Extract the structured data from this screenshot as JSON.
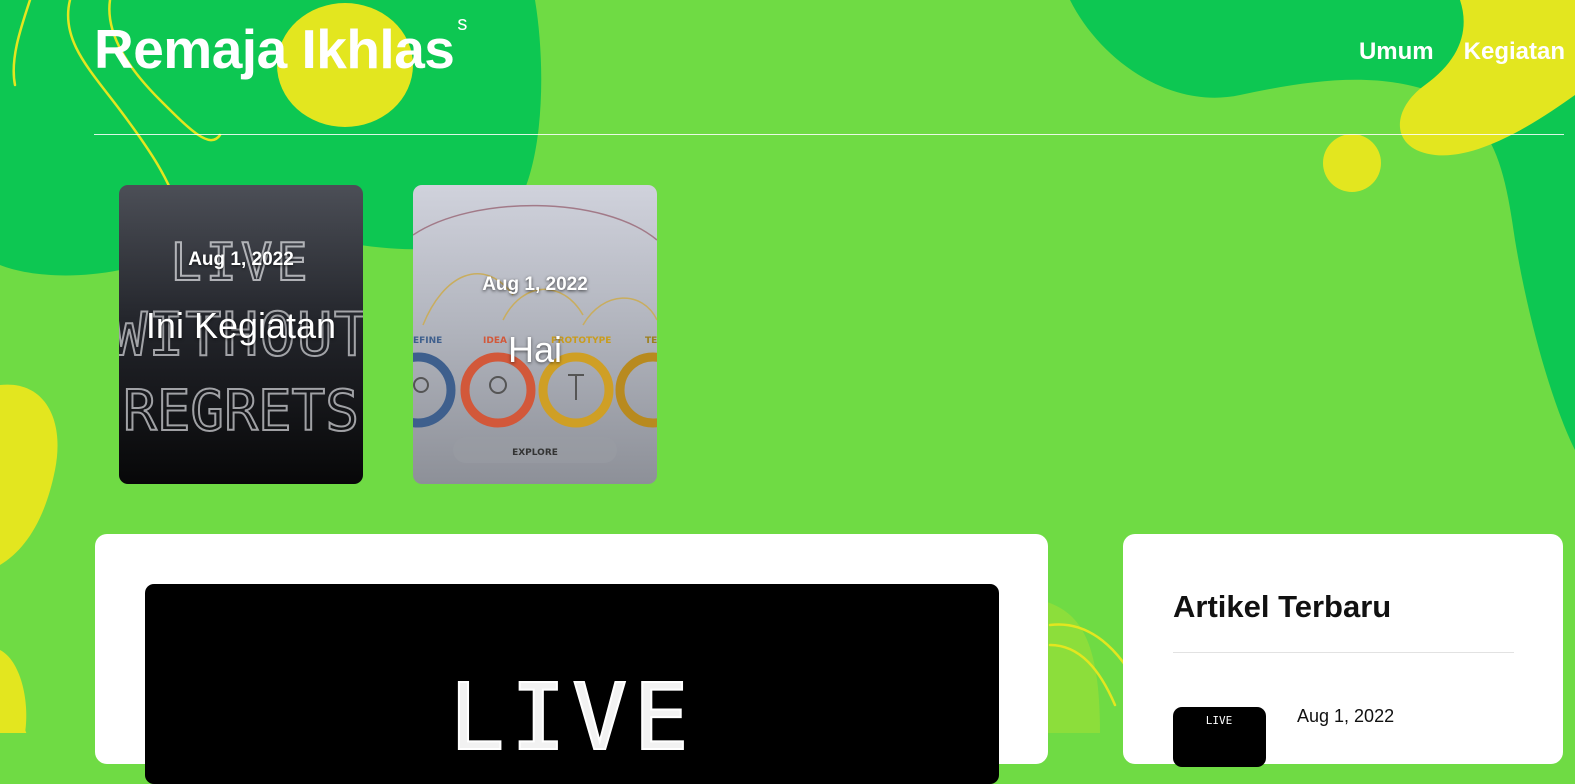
{
  "site": {
    "title": "Remaja Ikhlas",
    "title_sup": "s"
  },
  "nav": {
    "items": [
      "Umum",
      "Kegiatan"
    ]
  },
  "cards": [
    {
      "date": "Aug 1, 2022",
      "title": "Ini Kegiatan",
      "image_text": [
        "LIVE",
        "WITHOUT",
        "REGRETS"
      ]
    },
    {
      "date": "Aug 1, 2022",
      "title": "Hai",
      "image_labels": [
        "EFINE",
        "IDEA",
        "PROTOTYPE",
        "TE"
      ],
      "image_button": "EXPLORE"
    }
  ],
  "feature": {
    "image_text": "LIVE"
  },
  "sidebar": {
    "heading": "Artikel Terbaru",
    "recent": [
      {
        "date": "Aug 1, 2022",
        "thumb_text": "LIVE"
      }
    ]
  },
  "colors": {
    "background_light_green": "#6fdb44",
    "background_dark_green": "#0dc752",
    "accent_yellow": "#e3e61f",
    "panel_white": "#ffffff"
  }
}
